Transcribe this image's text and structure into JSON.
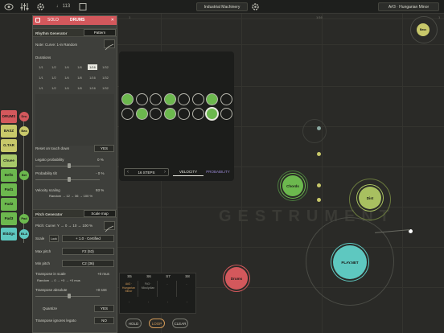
{
  "topbar": {
    "tempo": "♩ 113",
    "scale_name": "Industrial Machinery",
    "key_label": "A#3 · Hungarian Minor",
    "ruler_left": "1",
    "ruler_mid": "1/16",
    "ruler_right": "1"
  },
  "tracks": [
    {
      "label": "DRUMS",
      "color": "#d3585c",
      "dot": "Dru",
      "dot_color": "#d3585c"
    },
    {
      "label": "BASZ",
      "color": "#c8c86a",
      "dot": "Bas",
      "dot_color": "#c8c86a"
    },
    {
      "label": "G.TAR",
      "color": "#c8c86a",
      "dot": "",
      "dot_color": "#c8c86a"
    },
    {
      "label": "Chuee",
      "color": "#a8c86a",
      "dot": "",
      "dot_color": "#a8c86a"
    },
    {
      "label": "Bells",
      "color": "#6cb84e",
      "dot": "Bel",
      "dot_color": "#6cb84e"
    },
    {
      "label": "Pad1",
      "color": "#6cb84e",
      "dot": "",
      "dot_color": "#6cb84e"
    },
    {
      "label": "Pad2",
      "color": "#6cb84e",
      "dot": "",
      "dot_color": "#6cb84e"
    },
    {
      "label": "Pad3",
      "color": "#6cb84e",
      "dot": "Pad",
      "dot_color": "#6cb84e"
    },
    {
      "label": "Bl4dgs",
      "color": "#5ec8c0",
      "dot": "BLA",
      "dot_color": "#5ec8c0"
    }
  ],
  "panel": {
    "solo": "SOLO",
    "title": "DRUMS",
    "close": "✕",
    "rhythm_header": "Rhythm Generator",
    "rhythm_mode": "Pattern",
    "rhythm_desc": "Note: Curve: 1-in Random",
    "durations_label": "Durations",
    "durations": [
      [
        "1/1",
        "1/2",
        "1/4",
        "1/8",
        "1/16",
        "1/32"
      ],
      [
        "1/1",
        "1/2",
        "1/4",
        "1/8",
        "1/16",
        "1/32"
      ],
      [
        "1/1",
        "1/2",
        "1/4",
        "1/8",
        "1/16",
        "1/32"
      ]
    ],
    "reset_label": "Reset on touch down",
    "reset_val": "YES",
    "legato_label": "Legato probability",
    "legato_val": "0 %",
    "prob_label": "Probability tilt",
    "prob_val": "- 0 %",
    "vel_label": "Velocity scaling",
    "vel_val": "93 %",
    "vel_range": "Random → 12 → 36 → 100 %",
    "pitch_header": "Pitch Generator",
    "pitch_mode": "Scale map",
    "pitch_desc": "Pitch: Curve: Y → 0 → 10 → 100 %",
    "scale_label": "Scale",
    "scale_small": "Lock",
    "scale_val": "+ 1.0 · Certified",
    "maxp_label": "Max pitch",
    "maxp_val": "F2 (53)",
    "minp_label": "Min pitch",
    "minp_val": "C2 (36)",
    "trs_label": "Transpose in scale",
    "trs_val": "+0 mus",
    "trs_range": "Random → 0 → +0 → +0 mus",
    "tra_label": "Transpose absolute",
    "tra_val": "+0 smt",
    "quant_label": "Quantize",
    "quant_val": "YES",
    "tig_label": "Transpose ignores legato",
    "tig_val": "NO"
  },
  "sequencer": {
    "steps_label": "16 STEPS",
    "tab_velocity": "VELOCITY",
    "tab_probability": "PROBABILITY",
    "row1": [
      1,
      0,
      0,
      1,
      0,
      0,
      1,
      0
    ],
    "row2": [
      0,
      1,
      0,
      1,
      0,
      0,
      2,
      0
    ]
  },
  "bottom_grid": {
    "headers": [
      "S5",
      "S6",
      "S7",
      "S8"
    ],
    "cells": [
      {
        "text": "A#3 · Hungarian Minor",
        "highlight": true
      },
      {
        "text": "F#3 · Mixolydian",
        "highlight": false
      },
      {
        "text": "-",
        "highlight": false
      },
      {
        "text": "-",
        "highlight": false
      }
    ],
    "row2": [
      "-",
      "-",
      "-",
      "-"
    ]
  },
  "controls": {
    "hold": "HOLD",
    "loop": "LOOP",
    "clear": "CLEAR"
  },
  "nodes": {
    "chords": "Chords",
    "drums": "Drums",
    "dist": "Dist",
    "play": "PLAY.NET",
    "top": "Bass"
  },
  "watermark": "GESTRUMENT",
  "colors": {
    "accent_red": "#d3585c",
    "accent_green": "#6cb84e",
    "accent_teal": "#5ec8c0",
    "accent_yellow": "#c8c86a"
  }
}
